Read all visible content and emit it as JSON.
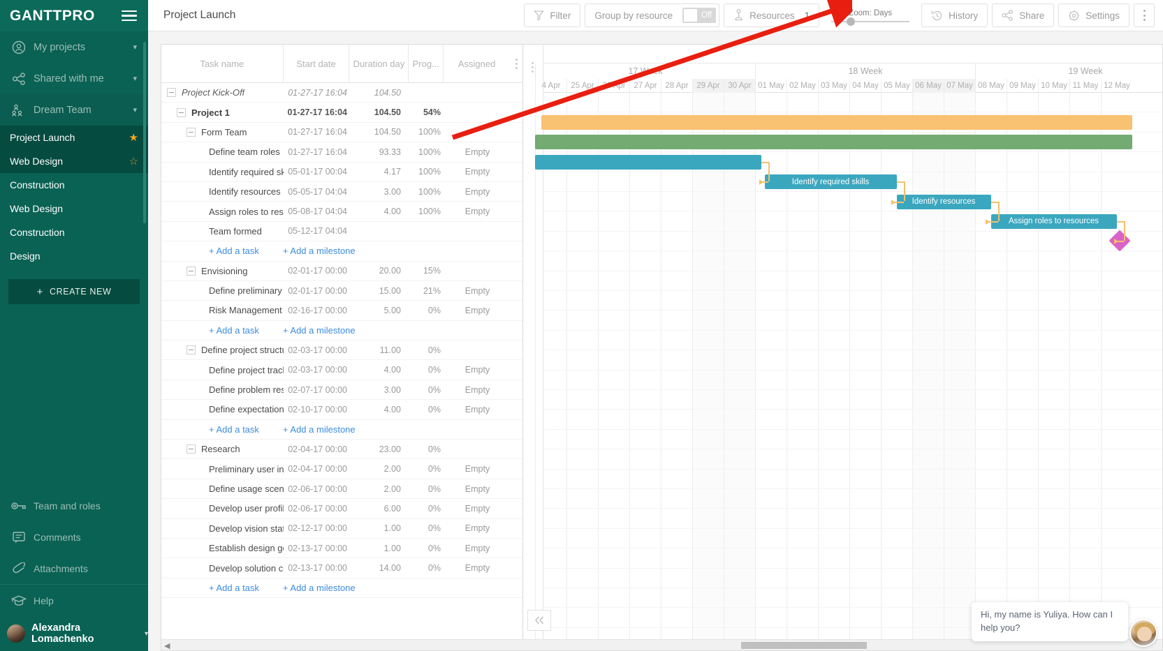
{
  "brand": {
    "logo": "GANTTPRO",
    "menu_icon": "hamburger-icon"
  },
  "sidebar": {
    "groups": [
      {
        "label": "My projects",
        "icon": "user-circle-icon"
      },
      {
        "label": "Shared with me",
        "icon": "share-nodes-icon"
      },
      {
        "label": "Dream Team",
        "icon": "team-icon"
      }
    ],
    "projects": [
      {
        "label": "Project Launch",
        "starred": true
      },
      {
        "label": "Web Design",
        "starred": false
      },
      {
        "label": "Construction",
        "starred": null
      },
      {
        "label": "Web Design",
        "starred": null
      },
      {
        "label": "Construction",
        "starred": null
      },
      {
        "label": "Design",
        "starred": null
      }
    ],
    "create_new": "CREATE NEW",
    "bottom_items": [
      {
        "label": "Team and roles",
        "icon": "key-icon"
      },
      {
        "label": "Comments",
        "icon": "comment-icon"
      },
      {
        "label": "Attachments",
        "icon": "paperclip-icon"
      },
      {
        "label": "Help",
        "icon": "graduation-cap-icon"
      }
    ],
    "user": {
      "name": "Alexandra Lomachenko"
    }
  },
  "topbar": {
    "title": "Project Launch",
    "filter": "Filter",
    "group_by_resource": "Group by resource",
    "toggle_state": "Off",
    "resources": "Resources",
    "resources_count": "1",
    "zoom_label": "Zoom: Days",
    "history": "History",
    "share": "Share",
    "settings": "Settings"
  },
  "grid": {
    "columns": [
      "Task name",
      "Start date",
      "Duration day",
      "Prog...",
      "Assigned"
    ],
    "add_task": "+ Add a task",
    "add_milestone": "+ Add a milestone",
    "rows": [
      {
        "type": "task",
        "level": 0,
        "expander": true,
        "name": "Project Kick-Off",
        "start": "01-27-17 16:04",
        "duration": "104.50",
        "progress": "",
        "assigned": ""
      },
      {
        "type": "task",
        "level": 1,
        "expander": true,
        "name": "Project 1",
        "start": "01-27-17 16:04",
        "duration": "104.50",
        "progress": "54%",
        "assigned": ""
      },
      {
        "type": "task",
        "level": 2,
        "expander": true,
        "name": "Form Team",
        "start": "01-27-17 16:04",
        "duration": "104.50",
        "progress": "100%",
        "assigned": ""
      },
      {
        "type": "task",
        "level": 3,
        "expander": false,
        "name": "Define team roles",
        "start": "01-27-17 16:04",
        "duration": "93.33",
        "progress": "100%",
        "assigned": "Empty"
      },
      {
        "type": "task",
        "level": 3,
        "expander": false,
        "name": "Identify required ski",
        "start": "05-01-17 00:04",
        "duration": "4.17",
        "progress": "100%",
        "assigned": "Empty"
      },
      {
        "type": "task",
        "level": 3,
        "expander": false,
        "name": "Identify resources",
        "start": "05-05-17 04:04",
        "duration": "3.00",
        "progress": "100%",
        "assigned": "Empty"
      },
      {
        "type": "task",
        "level": 3,
        "expander": false,
        "name": "Assign roles to resc",
        "start": "05-08-17 04:04",
        "duration": "4.00",
        "progress": "100%",
        "assigned": "Empty"
      },
      {
        "type": "task",
        "level": 3,
        "expander": false,
        "name": "Team formed",
        "start": "05-12-17 04:04",
        "duration": "",
        "progress": "",
        "assigned": ""
      },
      {
        "type": "add"
      },
      {
        "type": "task",
        "level": 2,
        "expander": true,
        "name": "Envisioning",
        "start": "02-01-17 00:00",
        "duration": "20.00",
        "progress": "15%",
        "assigned": ""
      },
      {
        "type": "task",
        "level": 3,
        "expander": false,
        "name": "Define preliminary l",
        "start": "02-01-17 00:00",
        "duration": "15.00",
        "progress": "21%",
        "assigned": "Empty"
      },
      {
        "type": "task",
        "level": 3,
        "expander": false,
        "name": "Risk Management",
        "start": "02-16-17 00:00",
        "duration": "5.00",
        "progress": "0%",
        "assigned": "Empty"
      },
      {
        "type": "add"
      },
      {
        "type": "task",
        "level": 2,
        "expander": true,
        "name": "Define project structur",
        "start": "02-03-17 00:00",
        "duration": "11.00",
        "progress": "0%",
        "assigned": ""
      },
      {
        "type": "task",
        "level": 3,
        "expander": false,
        "name": "Define project track",
        "start": "02-03-17 00:00",
        "duration": "4.00",
        "progress": "0%",
        "assigned": "Empty"
      },
      {
        "type": "task",
        "level": 3,
        "expander": false,
        "name": "Define problem res",
        "start": "02-07-17 00:00",
        "duration": "3.00",
        "progress": "0%",
        "assigned": "Empty"
      },
      {
        "type": "task",
        "level": 3,
        "expander": false,
        "name": "Define expectations",
        "start": "02-10-17 00:00",
        "duration": "4.00",
        "progress": "0%",
        "assigned": "Empty"
      },
      {
        "type": "add"
      },
      {
        "type": "task",
        "level": 2,
        "expander": true,
        "name": "Research",
        "start": "02-04-17 00:00",
        "duration": "23.00",
        "progress": "0%",
        "assigned": ""
      },
      {
        "type": "task",
        "level": 3,
        "expander": false,
        "name": "Preliminary user int",
        "start": "02-04-17 00:00",
        "duration": "2.00",
        "progress": "0%",
        "assigned": "Empty"
      },
      {
        "type": "task",
        "level": 3,
        "expander": false,
        "name": "Define usage scena",
        "start": "02-06-17 00:00",
        "duration": "2.00",
        "progress": "0%",
        "assigned": "Empty"
      },
      {
        "type": "task",
        "level": 3,
        "expander": false,
        "name": "Develop user profil",
        "start": "02-06-17 00:00",
        "duration": "6.00",
        "progress": "0%",
        "assigned": "Empty"
      },
      {
        "type": "task",
        "level": 3,
        "expander": false,
        "name": "Develop vision stat",
        "start": "02-12-17 00:00",
        "duration": "1.00",
        "progress": "0%",
        "assigned": "Empty"
      },
      {
        "type": "task",
        "level": 3,
        "expander": false,
        "name": "Establish design gc",
        "start": "02-13-17 00:00",
        "duration": "1.00",
        "progress": "0%",
        "assigned": "Empty"
      },
      {
        "type": "task",
        "level": 3,
        "expander": false,
        "name": "Develop solution cc",
        "start": "02-13-17 00:00",
        "duration": "14.00",
        "progress": "0%",
        "assigned": "Empty"
      },
      {
        "type": "add"
      }
    ]
  },
  "timeline": {
    "weeks": [
      {
        "label": "17 Week",
        "start_index": 0,
        "span": 7
      },
      {
        "label": "18 Week",
        "start_index": 7,
        "span": 7
      },
      {
        "label": "19 Week",
        "start_index": 14,
        "span": 7
      }
    ],
    "days": [
      {
        "label": "4 Apr",
        "weekend": false
      },
      {
        "label": "25 Apr",
        "weekend": false
      },
      {
        "label": "26 Apr",
        "weekend": false
      },
      {
        "label": "27 Apr",
        "weekend": false
      },
      {
        "label": "28 Apr",
        "weekend": false
      },
      {
        "label": "29 Apr",
        "weekend": true
      },
      {
        "label": "30 Apr",
        "weekend": true
      },
      {
        "label": "01 May",
        "weekend": false
      },
      {
        "label": "02 May",
        "weekend": false
      },
      {
        "label": "03 May",
        "weekend": false
      },
      {
        "label": "04 May",
        "weekend": false
      },
      {
        "label": "05 May",
        "weekend": false
      },
      {
        "label": "06 May",
        "weekend": true
      },
      {
        "label": "07 May",
        "weekend": true
      },
      {
        "label": "08 May",
        "weekend": false
      },
      {
        "label": "09 May",
        "weekend": false
      },
      {
        "label": "10 May",
        "weekend": false
      },
      {
        "label": "11 May",
        "weekend": false
      },
      {
        "label": "12 May",
        "weekend": false
      }
    ],
    "bars": [
      {
        "row": 1,
        "kind": "summary-orange",
        "start_day": 0.2,
        "end_day": 19.0,
        "label": "",
        "color": "#f9c172"
      },
      {
        "row": 2,
        "kind": "summary-green",
        "start_day": 0.0,
        "end_day": 19.0,
        "label": "",
        "color": "#73ab72"
      },
      {
        "row": 3,
        "kind": "task",
        "start_day": 0.0,
        "end_day": 7.2,
        "label": "",
        "color": "#3ba7bf"
      },
      {
        "row": 4,
        "kind": "task",
        "start_day": 7.3,
        "end_day": 11.5,
        "label": "Identify required skills",
        "color": "#3ba7bf"
      },
      {
        "row": 5,
        "kind": "task",
        "start_day": 11.5,
        "end_day": 14.5,
        "label": "Identify resources",
        "color": "#3ba7bf"
      },
      {
        "row": 6,
        "kind": "task",
        "start_day": 14.5,
        "end_day": 18.5,
        "label": "Assign roles to resources",
        "color": "#3ba7bf"
      },
      {
        "row": 7,
        "kind": "milestone",
        "start_day": 18.6,
        "end_day": 18.6,
        "label": "",
        "color": "#d963c8"
      }
    ],
    "dependency_color": "#f5c06a"
  },
  "chat": {
    "message": "Hi, my name is Yuliya. How can I help you?"
  },
  "colors": {
    "sidebar": "#0a6254",
    "accent_orange": "#f5a623",
    "bar_task": "#3ba7bf",
    "bar_summary_orange": "#f9c172",
    "bar_summary_green": "#73ab72",
    "milestone": "#d963c8",
    "link": "#3c8dde",
    "annotation_arrow": "#e81f10"
  }
}
